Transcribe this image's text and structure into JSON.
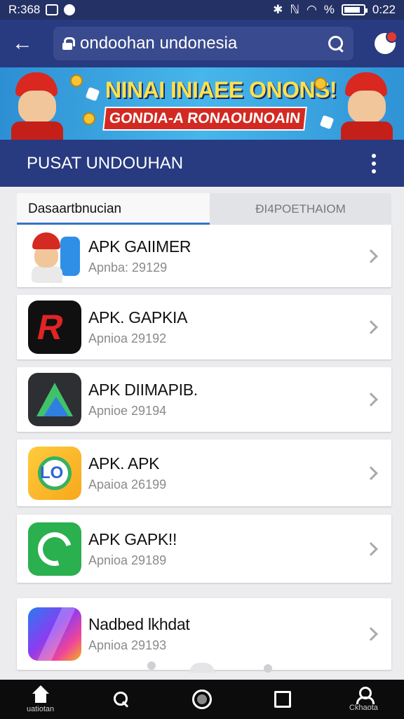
{
  "status_bar": {
    "carrier": "R:368",
    "time": "0:22",
    "signal_text": "%"
  },
  "header": {
    "search_text": "ondoohan undonesia"
  },
  "banner": {
    "title": "NINAI INIAEE ONONS!",
    "subtitle": "GONDIA-A RONAOUNOAIN"
  },
  "section": {
    "title": "PUSAT UNDOUHAN"
  },
  "tabs": [
    {
      "label": "Dasaartbnucian",
      "active": true
    },
    {
      "label": "ĐI4POETHAIOM",
      "active": false
    }
  ],
  "apps": [
    {
      "title": "APK GAIIMER",
      "subtitle": "Apnba: 29129",
      "icon": "game-character-icon"
    },
    {
      "title": "APK. GAPKIA",
      "subtitle": "Apnioa 29192",
      "icon": "red-r-icon"
    },
    {
      "title": "APK DIIMAPIB.",
      "subtitle": "Apnioe 29194",
      "icon": "triangle-icon"
    },
    {
      "title": "APK. APK",
      "subtitle": "Apaioa 26199",
      "icon": "lo-ring-icon"
    },
    {
      "title": "APK GAPK!!",
      "subtitle": "Apnioa 29189",
      "icon": "sync-icon"
    },
    {
      "title": "Nadbed lkhdat",
      "subtitle": "Apnioa 29193",
      "icon": "gradient-icon"
    }
  ],
  "bottom_nav": [
    {
      "label": "uatiotan",
      "icon": "home-icon"
    },
    {
      "label": "",
      "icon": "search-icon"
    },
    {
      "label": "",
      "icon": "circle-icon"
    },
    {
      "label": "",
      "icon": "square-icon"
    },
    {
      "label": "Ckhaota",
      "icon": "person-icon"
    }
  ],
  "colors": {
    "header_bg": "#283a80",
    "accent": "#3873c9",
    "badge": "#e23a32"
  }
}
